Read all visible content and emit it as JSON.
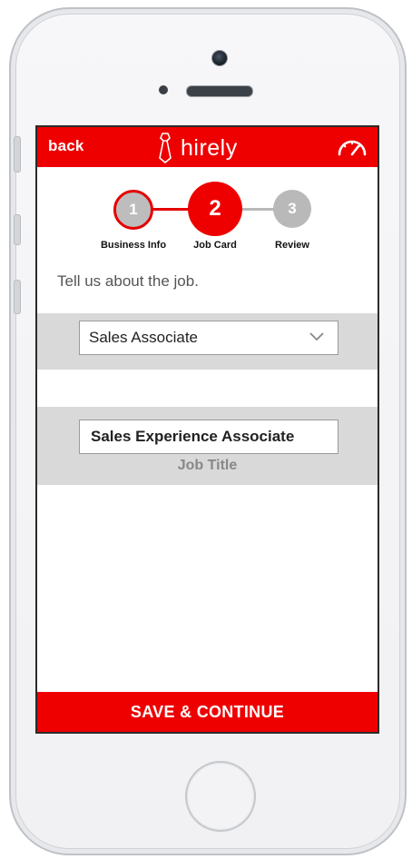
{
  "header": {
    "back_label": "back",
    "logo_text": "hirely",
    "logo_icon": "necktie-icon",
    "dashboard_icon": "speedometer-icon"
  },
  "progress": {
    "steps": [
      {
        "number": "1",
        "label": "Business Info",
        "state": "complete"
      },
      {
        "number": "2",
        "label": "Job Card",
        "state": "active"
      },
      {
        "number": "3",
        "label": "Review",
        "state": "upcoming"
      }
    ]
  },
  "form": {
    "prompt": "Tell us about the job.",
    "category_select": {
      "selected": "Sales Associate"
    },
    "job_title": {
      "value": "Sales Experience Associate",
      "caption": "Job Title"
    }
  },
  "footer": {
    "save_label": "SAVE & CONTINUE"
  },
  "colors": {
    "brand": "#ee0000",
    "inactive": "#b9b9b9",
    "band": "#d9d9d9"
  }
}
